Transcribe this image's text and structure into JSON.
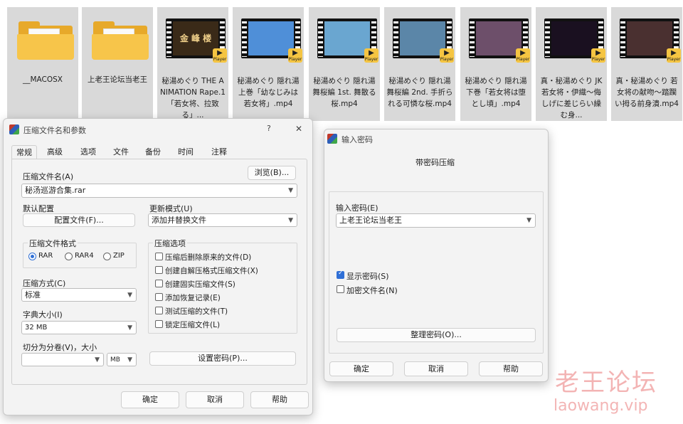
{
  "files": [
    {
      "type": "folder",
      "name": "__MACOSX"
    },
    {
      "type": "folder",
      "name": "上老王论坛当老王"
    },
    {
      "type": "video",
      "name": "秘湯めぐり THE ANIMATION Rape.1「若女将、拉致る」...",
      "thumb_color": "#3a2a18",
      "thumb_text": "金 峰 楼"
    },
    {
      "type": "video",
      "name": "秘湯めぐり 隠れ湯 上巻「幼なじみは若女将」.mp4",
      "thumb_color": "#4f8fd8",
      "thumb_text": ""
    },
    {
      "type": "video",
      "name": "秘湯めぐり 隠れ湯 舞桜編 1st. 舞散る桜.mp4",
      "thumb_color": "#6aa6d0",
      "thumb_text": ""
    },
    {
      "type": "video",
      "name": "秘湯めぐり 隠れ湯 舞桜編 2nd. 手折られる可憐な桜.mp4",
      "thumb_color": "#5b86a8",
      "thumb_text": ""
    },
    {
      "type": "video",
      "name": "秘湯めぐり 隠れ湯 下巻「若女将は堕とし頃」.mp4",
      "thumb_color": "#6d4f6a",
      "thumb_text": ""
    },
    {
      "type": "video",
      "name": "真・秘湯めぐり JK若女将・伊織〜侮しげに差じらい繰む身...",
      "thumb_color": "#1a1020",
      "thumb_text": ""
    },
    {
      "type": "video",
      "name": "真・秘湯めぐり 若女将の献吻〜踏躙い拇る前身潰.mp4",
      "thumb_color": "#4a3030",
      "thumb_text": ""
    }
  ],
  "player_badge": "Player",
  "archive_dialog": {
    "title": "压缩文件名和参数",
    "help_icon": "?",
    "close_icon": "✕",
    "tabs": [
      "常规",
      "高级",
      "选项",
      "文件",
      "备份",
      "时间",
      "注释"
    ],
    "archive_name_label": "压缩文件名(A)",
    "browse_label": "浏览(B)...",
    "archive_name_value": "秘汤巡游合集.rar",
    "default_config_label": "默认配置",
    "profile_button": "配置文件(F)...",
    "update_mode_label": "更新模式(U)",
    "update_mode_value": "添加并替换文件",
    "format_group_label": "压缩文件格式",
    "formats": [
      {
        "label": "RAR",
        "selected": true
      },
      {
        "label": "RAR4",
        "selected": false
      },
      {
        "label": "ZIP",
        "selected": false
      }
    ],
    "options_group_label": "压缩选项",
    "options": [
      {
        "label": "压缩后删除原来的文件(D)",
        "checked": false
      },
      {
        "label": "创建自解压格式压缩文件(X)",
        "checked": false
      },
      {
        "label": "创建固实压缩文件(S)",
        "checked": false
      },
      {
        "label": "添加恢复记录(E)",
        "checked": false
      },
      {
        "label": "测试压缩的文件(T)",
        "checked": false
      },
      {
        "label": "锁定压缩文件(L)",
        "checked": false
      }
    ],
    "method_label": "压缩方式(C)",
    "method_value": "标准",
    "dict_label": "字典大小(I)",
    "dict_value": "32 MB",
    "split_label": "切分为分卷(V)，大小",
    "split_value": "",
    "split_unit": "MB",
    "set_password_button": "设置密码(P)...",
    "ok_button": "确定",
    "cancel_button": "取消",
    "help_button": "帮助"
  },
  "password_dialog": {
    "title": "输入密码",
    "header": "带密码压缩",
    "password_label": "输入密码(E)",
    "password_value": "上老王论坛当老王",
    "show_password_label": "显示密码(S)",
    "show_password_checked": true,
    "encrypt_names_label": "加密文件名(N)",
    "encrypt_names_checked": false,
    "organize_button": "整理密码(O)...",
    "ok_button": "确定",
    "cancel_button": "取消",
    "help_button": "帮助"
  },
  "watermark": {
    "text": "老王论坛",
    "url": "laowang.vip"
  }
}
